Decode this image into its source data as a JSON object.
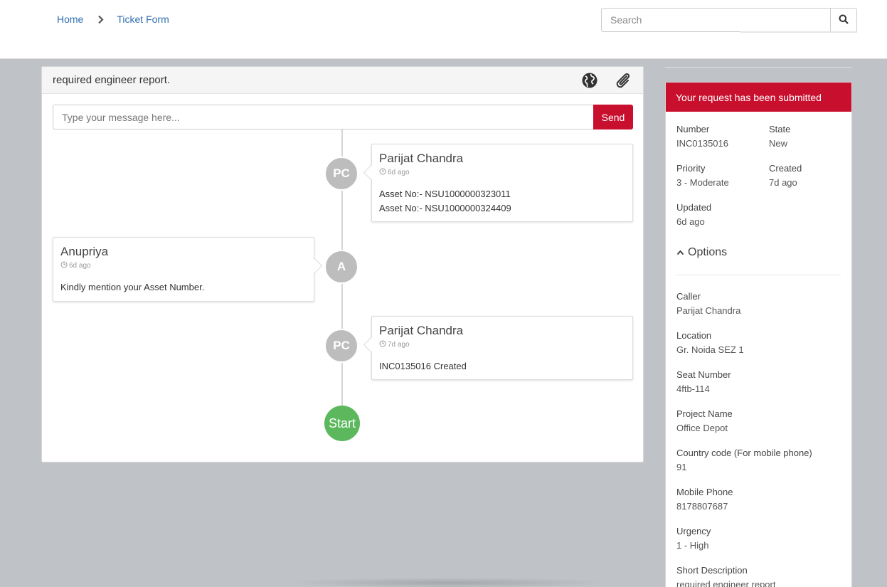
{
  "breadcrumb": {
    "home": "Home",
    "current": "Ticket Form"
  },
  "search": {
    "placeholder": "Search"
  },
  "card": {
    "title": "required engineer report.",
    "message_placeholder": "Type your message here...",
    "send_label": "Send"
  },
  "timeline": [
    {
      "initials": "PC",
      "name": "Parijat Chandra",
      "time": "6d ago",
      "lines": [
        "Asset No:-  NSU1000000323011",
        "Asset No:-  NSU1000000324409"
      ]
    },
    {
      "initials": "A",
      "name": "Anupriya",
      "time": "6d ago",
      "lines": [
        "Kindly mention your Asset Number."
      ]
    },
    {
      "initials": "PC",
      "name": "Parijat Chandra",
      "time": "7d ago",
      "lines": [
        "INC0135016 Created"
      ]
    }
  ],
  "start_label": "Start",
  "panel": {
    "title": "Your request has been submitted",
    "number_label": "Number",
    "number": "INC0135016",
    "state_label": "State",
    "state": "New",
    "priority_label": "Priority",
    "priority": "3 - Moderate",
    "created_label": "Created",
    "created": "7d ago",
    "updated_label": "Updated",
    "updated": "6d ago",
    "options_label": "Options",
    "fields": [
      {
        "label": "Caller",
        "value": "Parijat Chandra"
      },
      {
        "label": "Location",
        "value": "Gr. Noida SEZ 1"
      },
      {
        "label": "Seat Number",
        "value": "4ftb-114"
      },
      {
        "label": "Project Name",
        "value": "Office Depot"
      },
      {
        "label": "Country code (For mobile phone)",
        "value": "91"
      },
      {
        "label": "Mobile Phone",
        "value": "8178807687"
      },
      {
        "label": "Urgency",
        "value": "1 - High"
      },
      {
        "label": "Short Description",
        "value": "required engineer report"
      }
    ]
  },
  "colors": {
    "accent": "#c8102e",
    "start": "#5cb85c",
    "link": "#2f6fb0",
    "avatar": "#bdbdbd"
  },
  "icons": [
    "chevron-right-icon",
    "search-icon",
    "globe-icon",
    "paperclip-icon",
    "clock-icon",
    "chevron-up-icon"
  ]
}
